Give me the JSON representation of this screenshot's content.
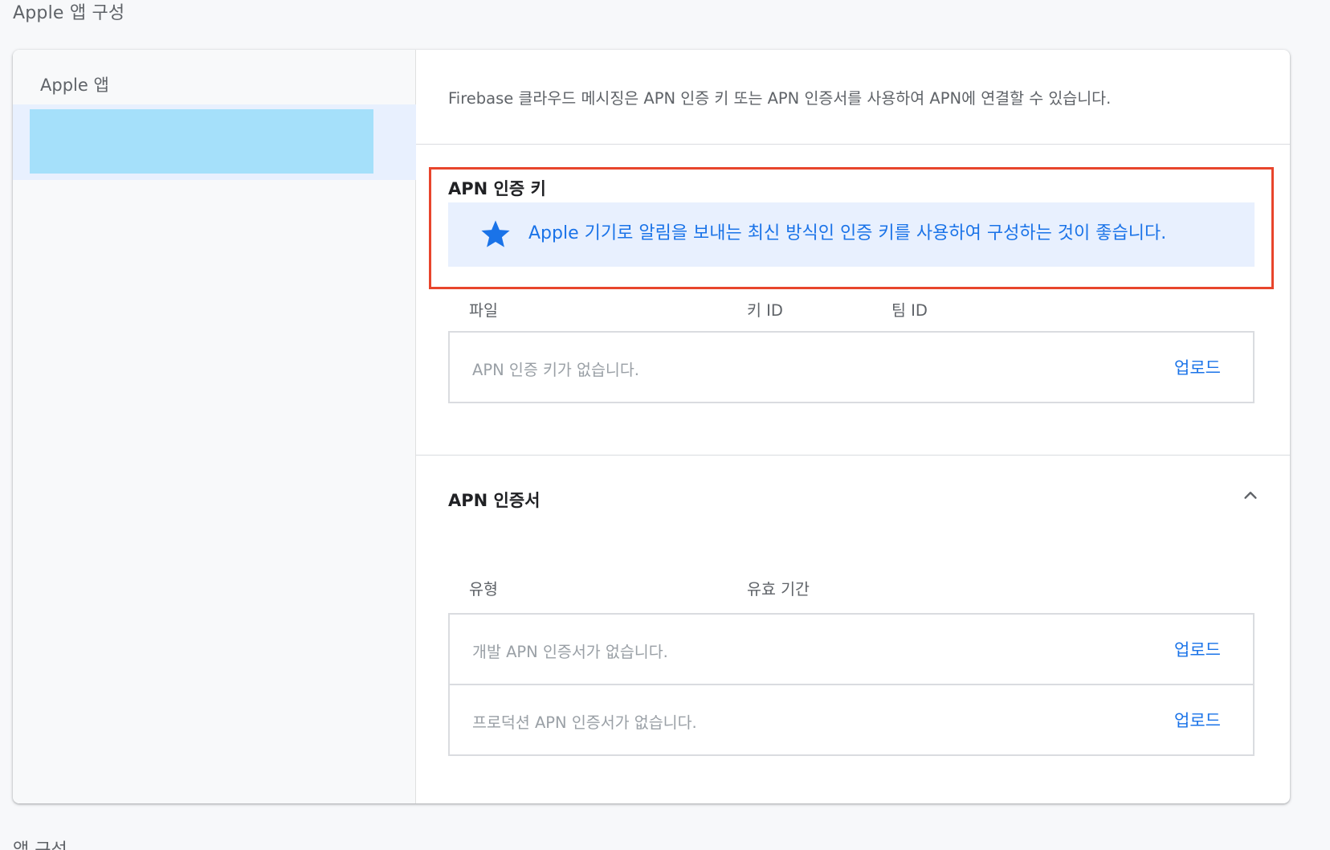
{
  "page": {
    "section_title": "Apple 앱 구성",
    "next_section_title": "앱 구성"
  },
  "left_panel": {
    "title": "Apple 앱"
  },
  "intro": {
    "text": "Firebase 클라우드 메시징은 APN 인증 키 또는 APN 인증서를 사용하여 APN에 연결할 수 있습니다."
  },
  "apn_key": {
    "title": "APN 인증 키",
    "notice": "Apple 기기로 알림을 보내는 최신 방식인 인증 키를 사용하여 구성하는 것이 좋습니다.",
    "notice_icon": "star-icon",
    "columns": [
      "파일",
      "키 ID",
      "팀 ID"
    ],
    "empty_text": "APN 인증 키가 없습니다.",
    "upload_label": "업로드"
  },
  "apn_cert": {
    "title": "APN 인증서",
    "toggle_icon": "chevron-up-icon",
    "columns": [
      "유형",
      "유효 기간"
    ],
    "rows": [
      {
        "empty_text": "개발 APN 인증서가 없습니다.",
        "upload_label": "업로드"
      },
      {
        "empty_text": "프로덕션 APN 인증서가 없습니다.",
        "upload_label": "업로드"
      }
    ]
  },
  "colors": {
    "accent": "#1a73e8",
    "highlight_border": "#e8452c",
    "notice_bg": "#e8f0fe",
    "selected_app_block": "#a5e0fa"
  }
}
